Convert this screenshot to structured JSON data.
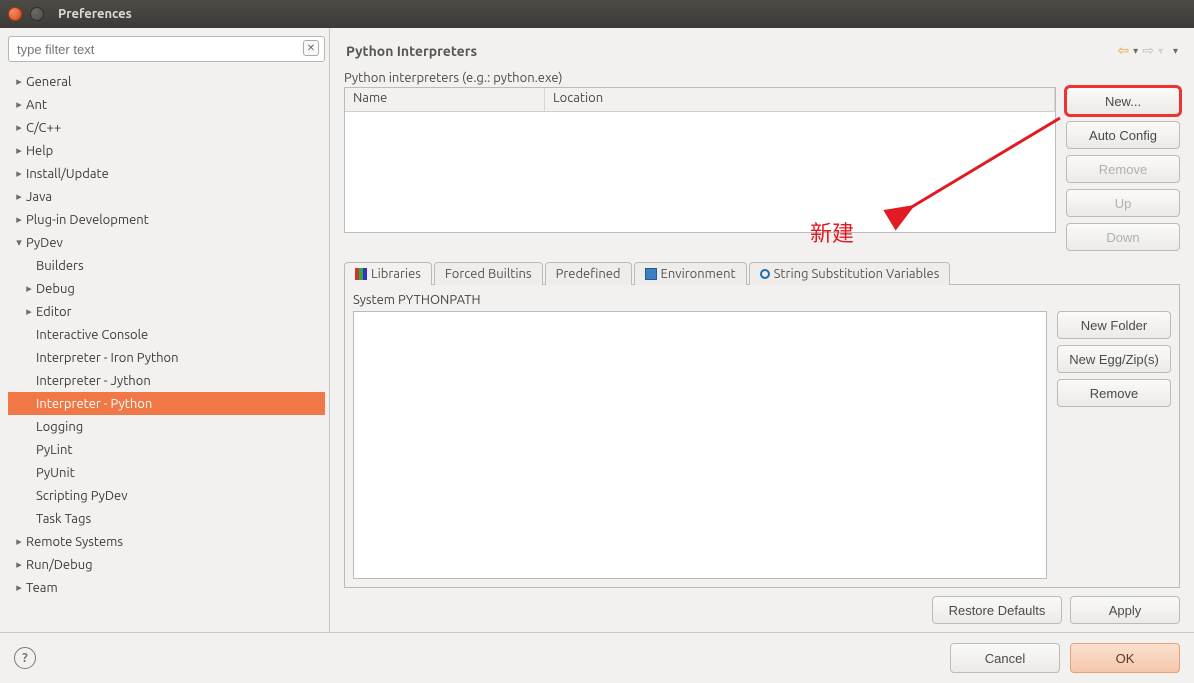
{
  "window": {
    "title": "Preferences"
  },
  "filter": {
    "placeholder": "type filter text"
  },
  "tree": {
    "general": "General",
    "ant": "Ant",
    "ccpp": "C/C++",
    "help": "Help",
    "install_update": "Install/Update",
    "java": "Java",
    "plugin_dev": "Plug-in Development",
    "pydev": "PyDev",
    "pydev_builders": "Builders",
    "pydev_debug": "Debug",
    "pydev_editor": "Editor",
    "pydev_interactive_console": "Interactive Console",
    "pydev_interp_iron": "Interpreter - Iron Python",
    "pydev_interp_jython": "Interpreter - Jython",
    "pydev_interp_python": "Interpreter - Python",
    "pydev_logging": "Logging",
    "pydev_pylint": "PyLint",
    "pydev_pyunit": "PyUnit",
    "pydev_scripting": "Scripting PyDev",
    "pydev_tasktags": "Task Tags",
    "remote_systems": "Remote Systems",
    "run_debug": "Run/Debug",
    "team": "Team"
  },
  "page": {
    "title": "Python Interpreters",
    "interp_label": "Python interpreters (e.g.: python.exe)",
    "col_name": "Name",
    "col_location": "Location"
  },
  "buttons": {
    "new": "New...",
    "auto_config": "Auto Config",
    "remove": "Remove",
    "up": "Up",
    "down": "Down",
    "new_folder": "New Folder",
    "new_egg": "New Egg/Zip(s)",
    "remove2": "Remove",
    "restore_defaults": "Restore Defaults",
    "apply": "Apply",
    "cancel": "Cancel",
    "ok": "OK"
  },
  "tabs": {
    "libraries": "Libraries",
    "forced_builtins": "Forced Builtins",
    "predefined": "Predefined",
    "environment": "Environment",
    "string_sub": "String Substitution Variables"
  },
  "system_path_label": "System PYTHONPATH",
  "annotation": {
    "text": "新建"
  }
}
